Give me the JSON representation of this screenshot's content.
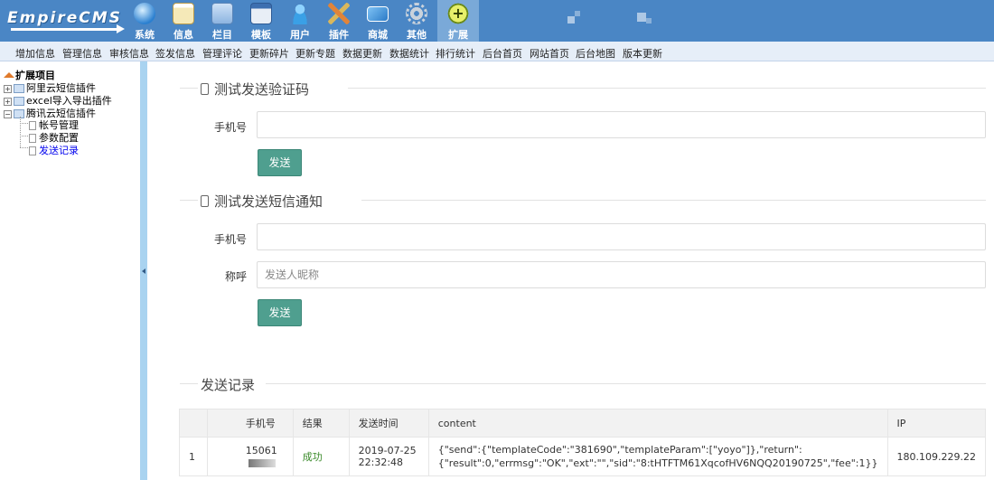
{
  "app": {
    "logo": "EmpireCMS",
    "nav": [
      {
        "label": "系统",
        "icon": "globe-icon"
      },
      {
        "label": "信息",
        "icon": "notepad-icon"
      },
      {
        "label": "栏目",
        "icon": "folder-icon"
      },
      {
        "label": "模板",
        "icon": "window-icon"
      },
      {
        "label": "用户",
        "icon": "user-icon"
      },
      {
        "label": "插件",
        "icon": "tools-icon"
      },
      {
        "label": "商城",
        "icon": "card-icon"
      },
      {
        "label": "其他",
        "icon": "gear-icon"
      },
      {
        "label": "扩展",
        "icon": "plus-icon",
        "active": true
      }
    ],
    "submenu": [
      "增加信息",
      "管理信息",
      "审核信息",
      "签发信息",
      "管理评论",
      "更新碎片",
      "更新专题",
      "数据更新",
      "数据统计",
      "排行统计",
      "后台首页",
      "网站首页",
      "后台地图",
      "版本更新"
    ]
  },
  "tree": {
    "root": "扩展项目",
    "nodes": [
      {
        "label": "阿里云短信插件"
      },
      {
        "label": "excel导入导出插件"
      },
      {
        "label": "腾讯云短信插件",
        "children": [
          {
            "label": "帐号管理"
          },
          {
            "label": "参数配置"
          },
          {
            "label": "发送记录",
            "current": true
          }
        ]
      }
    ]
  },
  "form1": {
    "title": "测试发送验证码",
    "phone_label": "手机号",
    "phone_value": "",
    "send_label": "发送"
  },
  "form2": {
    "title": "测试发送短信通知",
    "phone_label": "手机号",
    "phone_value": "",
    "name_label": "称呼",
    "name_placeholder": "发送人昵称",
    "send_label": "发送"
  },
  "log": {
    "title": "发送记录",
    "columns": [
      "",
      "手机号",
      "结果",
      "发送时间",
      "content",
      "IP"
    ],
    "rows": [
      {
        "index": "1",
        "phone": "15061",
        "result": "成功",
        "date": "2019-07-25",
        "time": "22:32:48",
        "content_line1": "{\"send\":{\"templateCode\":\"381690\",\"templateParam\":[\"yoyo\"]},\"return\":",
        "content_line2": "{\"result\":0,\"errmsg\":\"OK\",\"ext\":\"\",\"sid\":\"8:tHTFTM61XqcofHV6NQQ20190725\",\"fee\":1}}",
        "ip": "180.109.229.22"
      }
    ]
  },
  "colors": {
    "topbar": "#4a86c5",
    "button": "#4f9f8f",
    "splitter": "#a9d3f0",
    "link_current": "#0000ee"
  }
}
